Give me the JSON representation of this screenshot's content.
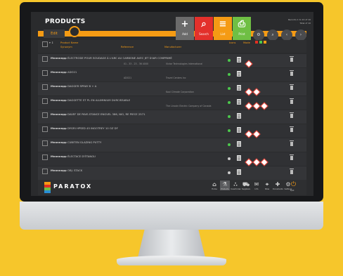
{
  "header": {
    "title": "PRODUCTS",
    "edit_label": "Edit",
    "info_line1": "Records 1 to 10 of 10",
    "info_line2": "Total of 10"
  },
  "toolbar": [
    {
      "label": "Add",
      "glyph": "+",
      "bg": "#6b6b6b",
      "icon": "plus-icon"
    },
    {
      "label": "Search",
      "glyph": "⌕",
      "bg": "#e3302b",
      "icon": "search-icon"
    },
    {
      "label": "List",
      "glyph": "≡",
      "bg": "#f59b14",
      "icon": "list-icon"
    },
    {
      "label": "Print",
      "glyph": "⎙",
      "bg": "#6fbf44",
      "icon": "print-icon"
    }
  ],
  "header_buttons": [
    {
      "glyph": "⚙",
      "label": "Settings",
      "icon": "settings-icon"
    },
    {
      "glyph": "⌕",
      "label": "Search",
      "icon": "search-icon"
    },
    {
      "glyph": "‹",
      "label": "",
      "icon": "prev-icon"
    },
    {
      "glyph": "›",
      "label": "",
      "icon": "next-icon"
    }
  ],
  "filters": {
    "product_name": "Product Name",
    "synonym": "Synonym",
    "reference": "Reference",
    "manufacturer": "Manufacturer",
    "icons": "Icons",
    "mode": "Mode"
  },
  "rows": [
    {
      "id": "Mnnnnnpp",
      "name": "ÉLECTRODE POUR SOUDAGE À L'ARC AU CARBONE AVEC JET D'AIR COMPRIMÉ ARCAIR",
      "reference": "01 - 33 - 23 - 36 4000",
      "manufacturer": "Victor Technologies International",
      "status": "#4cc94c",
      "pictos": 1
    },
    {
      "id": "Mnnnnnpp",
      "name": "ADO21",
      "reference": "ADO21",
      "manufacturer": "Travel Centers Inc",
      "status": "#4cc94c",
      "pictos": 0
    },
    {
      "id": "Mnnnnnpp",
      "name": "DAGGER SPRAY B + A",
      "reference": "",
      "manufacturer": "Kool Climate Corporation",
      "status": "#4cc94c",
      "pictos": 2
    },
    {
      "id": "Mnnnnnpp",
      "name": "DAGGETTE ST PL EN ALUMINIUM DURCISSABLE",
      "reference": "",
      "manufacturer": "The Lincoln Electric Company of Canada",
      "status": "#4cc94c",
      "pictos": 3
    },
    {
      "id": "Mnnnnnpp",
      "name": "DAVEF DE PAVE-STANCE ENGVEL 386, NIO, RE PIECE 2571",
      "reference": "",
      "manufacturer": "",
      "status": "#4cc94c",
      "pictos": 0
    },
    {
      "id": "Mnnnnnpp",
      "name": "DYGRI HPSED 45 INGOTREY 10 OZ DF",
      "reference": "",
      "manufacturer": "",
      "status": "#4cc94c",
      "pictos": 2
    },
    {
      "id": "Mnnnnnpp",
      "name": "CUBITEN GLAZING PUTTY",
      "reference": "",
      "manufacturer": "",
      "status": "#4cc94c",
      "pictos": 0
    },
    {
      "id": "Mnnnnnpp",
      "name": "ÉLECTACE D'ÉTANGU",
      "reference": "",
      "manufacturer": "",
      "status": "#cccccc",
      "pictos": 3
    },
    {
      "id": "Mnnnnnpp",
      "name": "OBJ. STACK",
      "reference": "",
      "manufacturer": "",
      "status": "#cccccc",
      "pictos": 0
    }
  ],
  "brand": "PARATOX",
  "nav": [
    {
      "label": "Home",
      "glyph": "⌂",
      "icon": "home-icon"
    },
    {
      "label": "Products",
      "glyph": "⚗",
      "icon": "flask-icon",
      "active": true
    },
    {
      "label": "Inventories",
      "glyph": "∴",
      "icon": "inventory-icon"
    },
    {
      "label": "Suppliers",
      "glyph": "⛟",
      "icon": "truck-icon"
    },
    {
      "label": "Info",
      "glyph": "✉",
      "icon": "mail-icon"
    },
    {
      "label": "Sites",
      "glyph": "⌖",
      "icon": "globe-icon"
    },
    {
      "label": "Documents",
      "glyph": "✚",
      "icon": "documents-icon"
    },
    {
      "label": "Settings",
      "glyph": "⚙",
      "icon": "gear-icon"
    },
    {
      "label": "Quit",
      "glyph": "⏻",
      "icon": "power-icon"
    }
  ]
}
